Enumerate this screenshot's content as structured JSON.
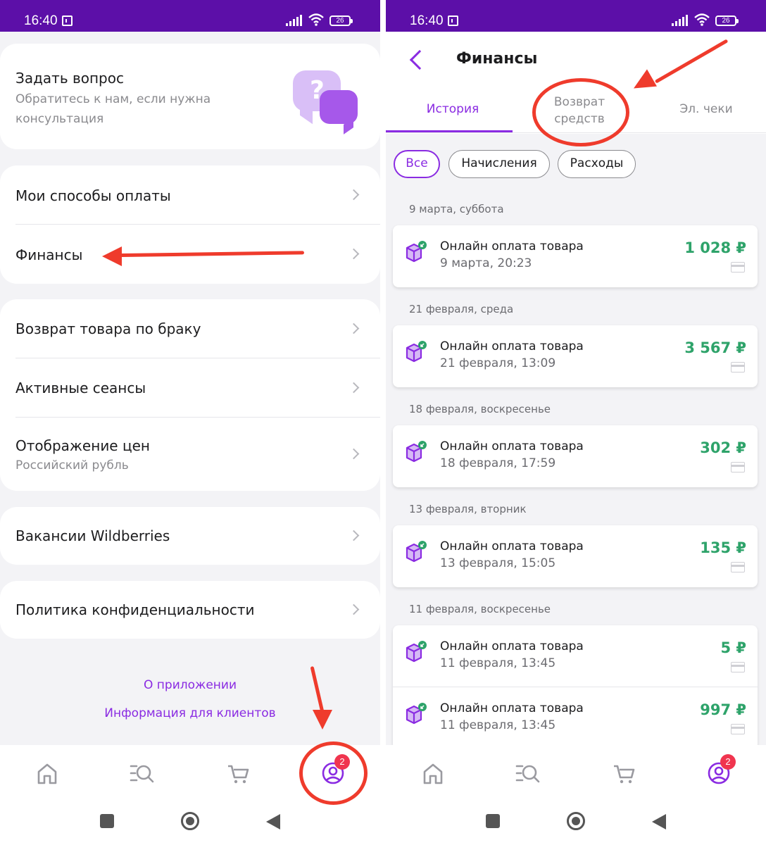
{
  "status_bar": {
    "time": "16:40",
    "battery": "26"
  },
  "left": {
    "ask": {
      "title": "Задать вопрос",
      "subtitle_line1": "Обратитесь к нам, если нужна",
      "subtitle_line2": "консультация"
    },
    "payment_methods": "Мои способы оплаты",
    "finance": "Финансы",
    "defect_return": "Возврат товара по браку",
    "active_sessions": "Активные сеансы",
    "price_display": {
      "title": "Отображение цен",
      "value": "Российский рубль"
    },
    "vacancies": "Вакансии Wildberries",
    "privacy": "Политика конфиденциальности",
    "about_app": "О приложении",
    "client_info": "Информация для клиентов",
    "profile_badge": "2"
  },
  "right": {
    "title": "Финансы",
    "tabs": [
      {
        "label": "История",
        "active": true
      },
      {
        "label_line1": "Возврат",
        "label_line2": "средств"
      },
      {
        "label": "Эл. чеки"
      }
    ],
    "chips": [
      "Все",
      "Начисления",
      "Расходы"
    ],
    "groups": [
      {
        "date": "9 марта, суббота",
        "items": [
          {
            "title": "Онлайн оплата товара",
            "time": "9 марта, 20:23",
            "amount": "1 028 ₽"
          }
        ]
      },
      {
        "date": "21 февраля, среда",
        "items": [
          {
            "title": "Онлайн оплата товара",
            "time": "21 февраля, 13:09",
            "amount": "3 567 ₽"
          }
        ]
      },
      {
        "date": "18 февраля, воскресенье",
        "items": [
          {
            "title": "Онлайн оплата товара",
            "time": "18 февраля, 17:59",
            "amount": "302 ₽"
          }
        ]
      },
      {
        "date": "13 февраля, вторник",
        "items": [
          {
            "title": "Онлайн оплата товара",
            "time": "13 февраля, 15:05",
            "amount": "135 ₽"
          }
        ]
      },
      {
        "date": "11 февраля, воскресенье",
        "items": [
          {
            "title": "Онлайн оплата товара",
            "time": "11 февраля, 13:45",
            "amount": "5 ₽"
          },
          {
            "title": "Онлайн оплата товара",
            "time": "11 февраля, 13:45",
            "amount": "997 ₽"
          }
        ]
      }
    ],
    "profile_badge": "2"
  },
  "colors": {
    "status_bar": "#5c0fa8",
    "accent": "#8a2be2",
    "amount_green": "#2ea36a",
    "annotation_red": "#ef3b2c",
    "badge_red": "#f0354f"
  },
  "icons": [
    "home-icon",
    "catalog-search-icon",
    "cart-icon",
    "profile-icon",
    "square-recent-icon",
    "circle-home-icon",
    "triangle-back-icon",
    "package-icon",
    "card-icon",
    "chevron-right-icon"
  ]
}
